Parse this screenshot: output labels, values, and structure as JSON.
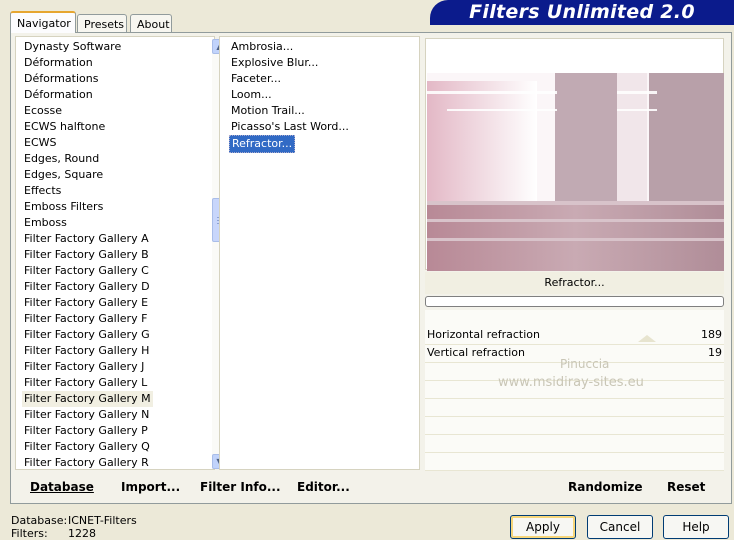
{
  "tabs": [
    {
      "label": "Navigator"
    },
    {
      "label": "Presets"
    },
    {
      "label": "About"
    }
  ],
  "banner": {
    "title": "Filters Unlimited 2.0"
  },
  "categories": [
    "Dynasty Software",
    "Déformation",
    "Déformations",
    "Déformation",
    "Ecosse",
    "ECWS halftone",
    "ECWS",
    "Edges, Round",
    "Edges, Square",
    "Effects",
    "Emboss Filters",
    "Emboss",
    "Filter Factory Gallery A",
    "Filter Factory Gallery B",
    "Filter Factory Gallery C",
    "Filter Factory Gallery D",
    "Filter Factory Gallery E",
    "Filter Factory Gallery F",
    "Filter Factory Gallery G",
    "Filter Factory Gallery H",
    "Filter Factory Gallery J",
    "Filter Factory Gallery L",
    "Filter Factory Gallery M",
    "Filter Factory Gallery N",
    "Filter Factory Gallery P",
    "Filter Factory Gallery Q",
    "Filter Factory Gallery R"
  ],
  "filters": [
    "Ambrosia...",
    "Explosive Blur...",
    "Faceter...",
    "Loom...",
    "Motion Trail...",
    "Picasso's Last Word...",
    "Refractor..."
  ],
  "preview": {
    "filter_name": "Refractor...",
    "watermark_line1": "Pinuccia",
    "watermark_line2": "www.msidiray-sites.eu"
  },
  "params": [
    {
      "name": "Horizontal refraction",
      "value": "189"
    },
    {
      "name": "Vertical refraction",
      "value": "19"
    }
  ],
  "bottom": {
    "database_label": "Database",
    "import_label": "Import...",
    "filter_info_label": "Filter Info...",
    "editor_label": "Editor...",
    "randomize_label": "Randomize",
    "reset_label": "Reset"
  },
  "status": {
    "database_caption": "Database:",
    "database_value": "ICNET-Filters",
    "filters_caption": "Filters:",
    "filters_value": "1228"
  },
  "buttons": {
    "apply": "Apply",
    "cancel": "Cancel",
    "help": "Help"
  },
  "colors": {
    "banner": "#0b1b8c",
    "selection": "#316ac5",
    "face": "#ece9d8"
  }
}
